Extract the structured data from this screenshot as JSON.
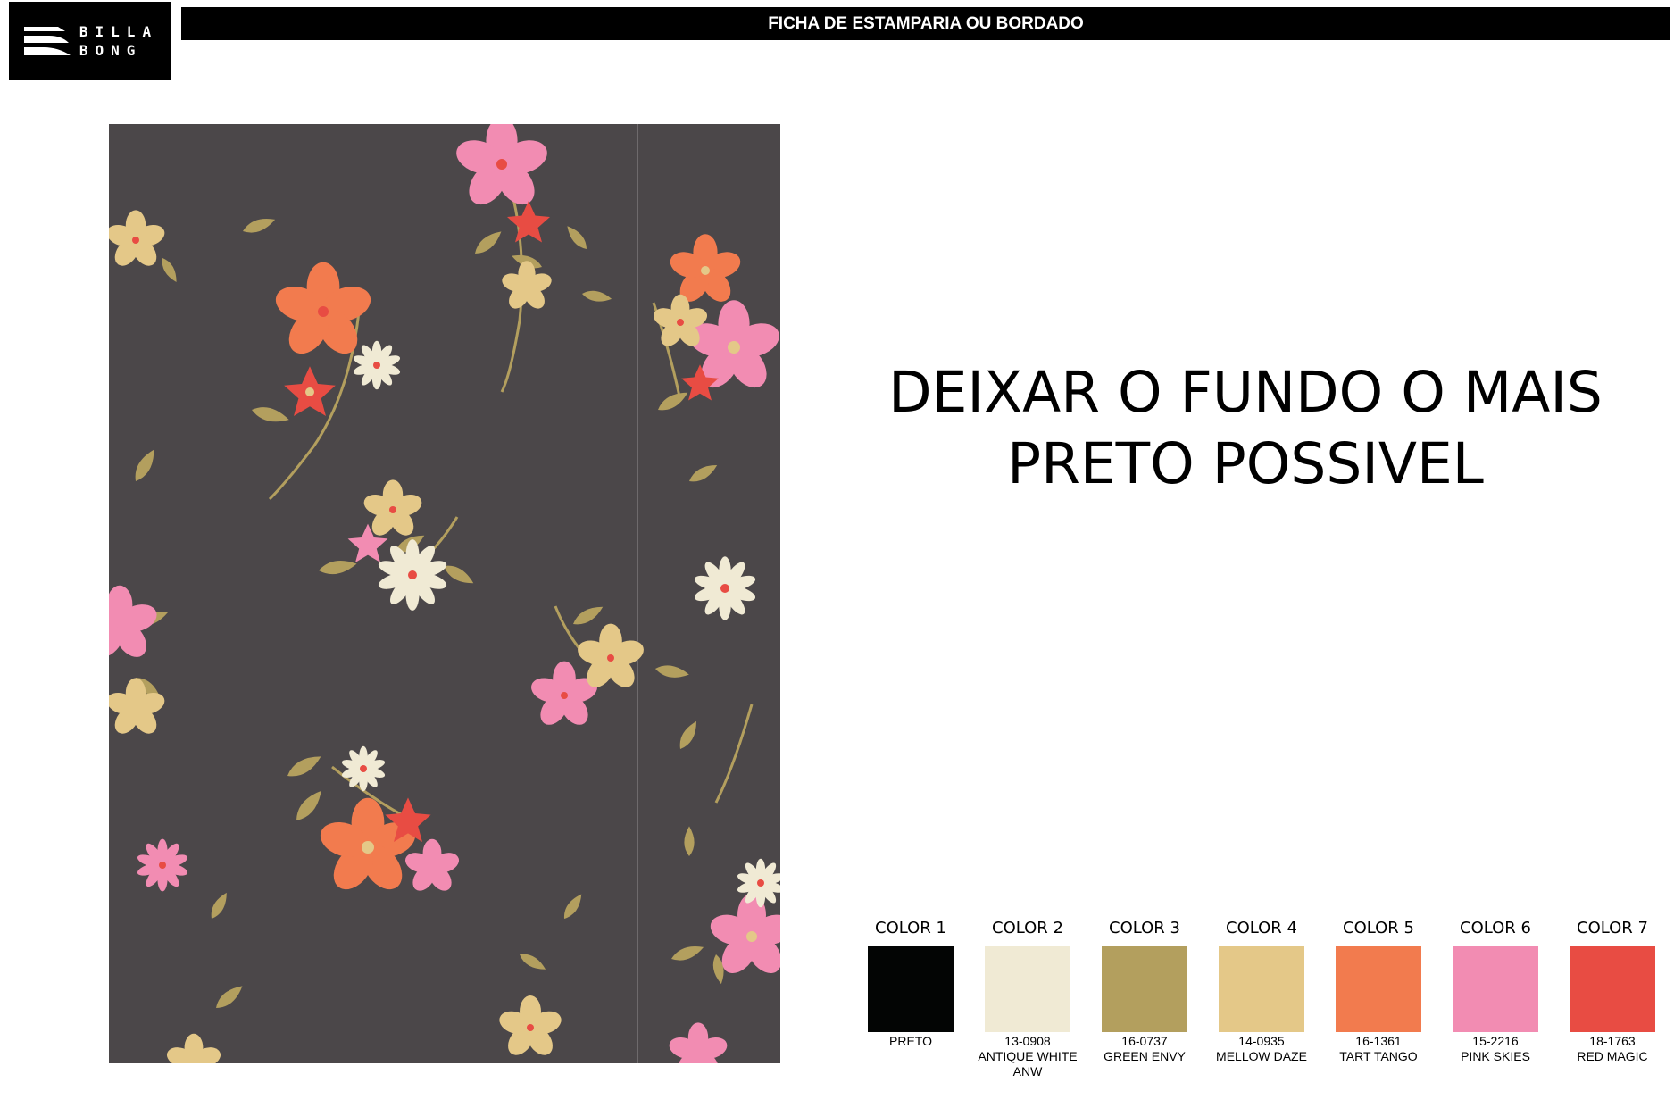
{
  "logo": {
    "line1": "BILLA",
    "line2": "BONG"
  },
  "header": {
    "title": "FICHA DE ESTAMPARIA OU BORDADO"
  },
  "instruction": {
    "line1": "DEIXAR O FUNDO O MAIS",
    "line2": "PRETO POSSIVEL"
  },
  "print": {
    "background": "#4b4749",
    "divider": "#7a7678"
  },
  "palette": [
    {
      "label": "COLOR 1",
      "color": "#030504",
      "code": "",
      "name": "PRETO",
      "extra": ""
    },
    {
      "label": "COLOR 2",
      "color": "#f0ead4",
      "code": "13-0908",
      "name": "ANTIQUE WHITE",
      "extra": "ANW"
    },
    {
      "label": "COLOR 3",
      "color": "#b39f5e",
      "code": "16-0737",
      "name": "GREEN ENVY",
      "extra": ""
    },
    {
      "label": "COLOR 4",
      "color": "#e4c888",
      "code": "14-0935",
      "name": "MELLOW DAZE",
      "extra": ""
    },
    {
      "label": "COLOR 5",
      "color": "#f27b4e",
      "code": "16-1361",
      "name": "TART TANGO",
      "extra": ""
    },
    {
      "label": "COLOR 6",
      "color": "#f28cb2",
      "code": "15-2216",
      "name": "PINK SKIES",
      "extra": ""
    },
    {
      "label": "COLOR 7",
      "color": "#e84c43",
      "code": "18-1763",
      "name": "RED MAGIC",
      "extra": ""
    }
  ]
}
